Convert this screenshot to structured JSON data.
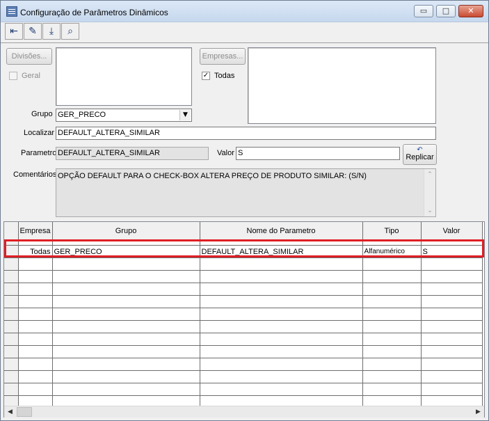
{
  "window": {
    "title": "Configuração de Parâmetros Dinâmicos",
    "icon": "table-icon",
    "controls": {
      "minimize": "▭",
      "maximize": "□",
      "close": "✕"
    }
  },
  "toolbar": {
    "buttons": [
      {
        "name": "exit-door-icon",
        "glyph": "⇤"
      },
      {
        "name": "eraser-icon",
        "glyph": "✎"
      },
      {
        "name": "download-tray-icon",
        "glyph": "⤓"
      },
      {
        "name": "binoculars-icon",
        "glyph": "⌕"
      }
    ]
  },
  "filters": {
    "divisoes_button": "Divisões...",
    "geral_label": "Geral",
    "geral_checked": false,
    "empresas_button": "Empresas...",
    "todas_label": "Todas",
    "todas_checked": true,
    "check_glyph": "✓"
  },
  "form": {
    "grupo_label": "Grupo",
    "grupo_value": "GER_PRECO",
    "localizar_label": "Localizar",
    "localizar_value": "DEFAULT_ALTERA_SIMILAR",
    "parametro_label": "Parametro",
    "parametro_value": "DEFAULT_ALTERA_SIMILAR",
    "valor_label": "Valor",
    "valor_value": "S",
    "replicar_label": "Replicar",
    "comentarios_label": "Comentários",
    "comentarios_value": "OPÇÃO DEFAULT PARA O CHECK-BOX ALTERA PREÇO DE PRODUTO SIMILAR: (S/N)"
  },
  "grid": {
    "columns": [
      "Empresa",
      "Grupo",
      "Nome do Parametro",
      "Tipo",
      "Valor"
    ],
    "rows": [
      [
        "Todas",
        "GER_PRECO",
        "DEFAULT_ALTERA_SIMILAR",
        "Alfanumérico",
        "S"
      ]
    ],
    "highlight_color": "#e01e24"
  }
}
